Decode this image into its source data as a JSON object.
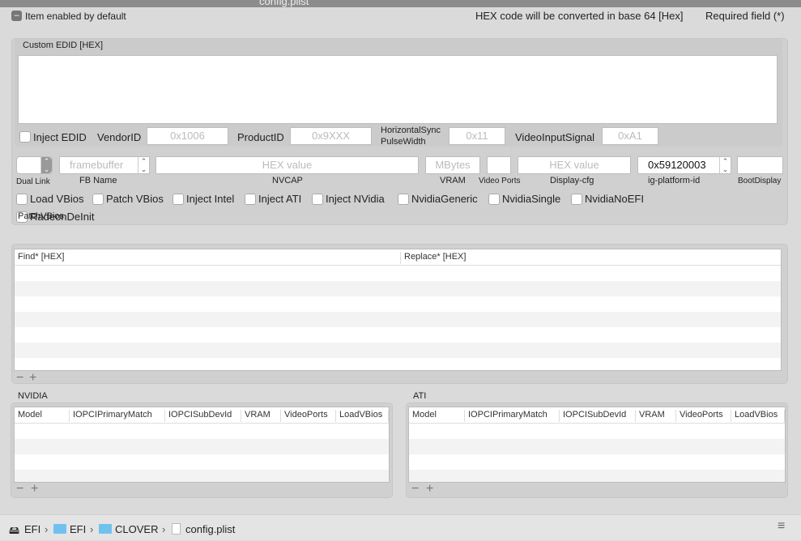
{
  "window": {
    "title": "config.plist"
  },
  "top": {
    "item_enabled": "Item enabled by default",
    "hex_note": "HEX code will be converted in base 64 [Hex]",
    "required": "Required field (*)"
  },
  "edid": {
    "title": "Custom EDID [HEX]",
    "value": "",
    "inject_label": "Inject EDID",
    "vendor_label": "VendorID",
    "vendor_ph": "0x1006",
    "product_label": "ProductID",
    "product_ph": "0x9XXX",
    "hsync_label1": "HorizontalSync",
    "hsync_label2": "PulseWidth",
    "hsync_ph": "0x11",
    "vis_label": "VideoInputSignal",
    "vis_ph": "0xA1"
  },
  "gfx": {
    "dual_link": "Dual Link",
    "fb_ph": "framebuffer",
    "fb_label": "FB Name",
    "nvcap_ph": "HEX value",
    "nvcap_label": "NVCAP",
    "vram_ph": "MBytes",
    "vram_label": "VRAM",
    "ports_label": "Video Ports",
    "dcfg_ph": "HEX value",
    "dcfg_label": "Display-cfg",
    "ig_value": "0x59120003",
    "ig_label": "ig-platform-id",
    "boot_label": "BootDisplay"
  },
  "checks": [
    "Load VBios",
    "Patch VBios",
    "Inject Intel",
    "Inject ATI",
    "Inject NVidia",
    "NvidiaGeneric",
    "NvidiaSingle",
    "NvidiaNoEFI",
    "RadeonDeInit"
  ],
  "patch": {
    "title": "PatchVBios",
    "columns": [
      "Find* [HEX]",
      "Replace* [HEX]"
    ]
  },
  "nvidia": {
    "title": "NVIDIA",
    "columns": [
      "Model",
      "IOPCIPrimaryMatch",
      "IOPCISubDevId",
      "VRAM",
      "VideoPorts",
      "LoadVBios"
    ]
  },
  "ati": {
    "title": "ATI",
    "columns": [
      "Model",
      "IOPCIPrimaryMatch",
      "IOPCISubDevId",
      "VRAM",
      "VideoPorts",
      "LoadVBios"
    ]
  },
  "footer": {
    "crumbs": [
      "EFI",
      "EFI",
      "CLOVER",
      "config.plist"
    ]
  }
}
